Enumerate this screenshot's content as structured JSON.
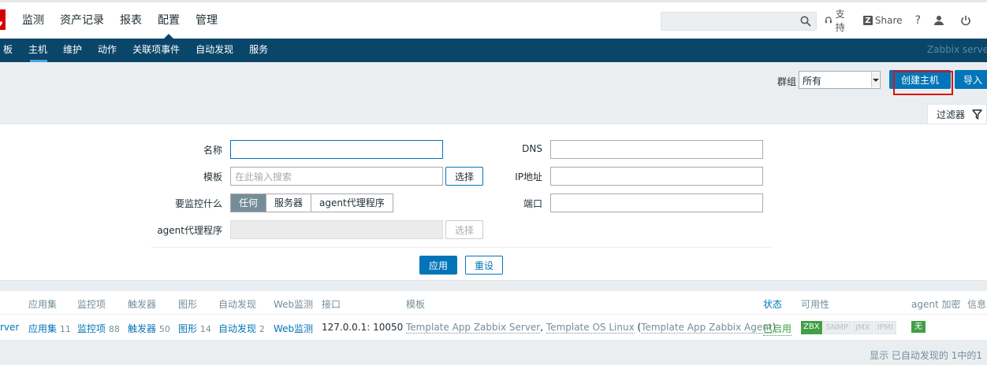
{
  "topbar": {
    "logo_text": "Z",
    "nav": [
      "监测",
      "资产记录",
      "报表",
      "配置",
      "管理"
    ],
    "active_nav": 3,
    "search_placeholder": "",
    "support_label": "支持",
    "share_badge": "Z",
    "share_label": "Share",
    "help_label": "?"
  },
  "subnav": {
    "items": [
      "板",
      "主机",
      "维护",
      "动作",
      "关联项事件",
      "自动发现",
      "服务"
    ],
    "server_label": "Zabbix serve"
  },
  "header": {
    "group_label": "群组",
    "group_value": "所有",
    "create_host_label": "创建主机",
    "import_label": "导入",
    "accent_color": "#0275b8",
    "highlight_color": "#dd1111"
  },
  "filter": {
    "tab_label": "过滤器",
    "name_label": "名称",
    "name_value": "",
    "template_label": "模板",
    "template_placeholder": "在此输入搜索",
    "select_label": "选择",
    "monitor_label": "要监控什么",
    "monitor_options": [
      "任何",
      "服务器",
      "agent代理程序"
    ],
    "monitor_selected": 0,
    "agent_label": "agent代理程序",
    "agent_select_label": "选择",
    "dns_label": "DNS",
    "dns_value": "",
    "ip_label": "IP地址",
    "ip_value": "",
    "port_label": "端口",
    "port_value": "",
    "apply_label": "应用",
    "reset_label": "重设"
  },
  "table": {
    "headers": {
      "apps": "应用集",
      "items": "监控项",
      "triggers": "触发器",
      "graphs": "图形",
      "discovery": "自动发现",
      "web": "Web监测",
      "interface": "接口",
      "templates": "模板",
      "status": "状态",
      "availability": "可用性",
      "encryption": "agent 加密",
      "info": "信息"
    },
    "row": {
      "name": "rver",
      "apps": "应用集",
      "apps_count": "11",
      "items": "监控项",
      "items_count": "88",
      "triggers": "触发器",
      "triggers_count": "50",
      "graphs": "图形",
      "graphs_count": "14",
      "discovery": "自动发现",
      "discovery_count": "2",
      "web": "Web监测",
      "interface": "127.0.0.1: 10050",
      "template1": "Template App Zabbix Server",
      "sep": ", ",
      "template2": "Template OS Linux",
      "paren_open": " (",
      "template3": "Template App Zabbix Agent",
      "paren_close": ")",
      "status": "已启用",
      "avail_zbx": "ZBX",
      "avail_snmp": "SNMP",
      "avail_jmx": "JMX",
      "avail_ipmi": "IPMI",
      "encryption": "无"
    }
  },
  "footer": {
    "summary": "显示 已自动发现的 1中的1"
  }
}
